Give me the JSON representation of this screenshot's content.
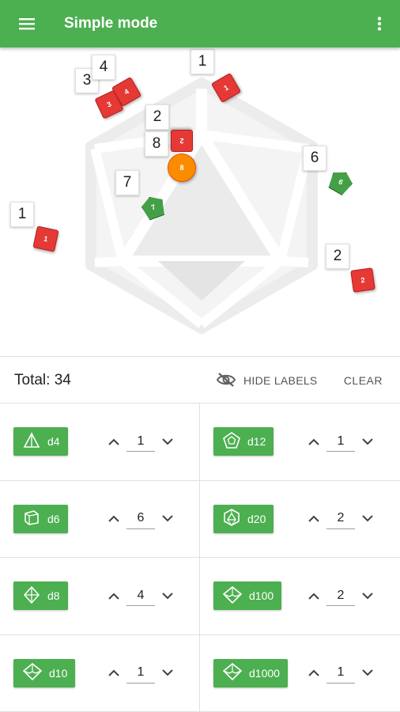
{
  "appbar": {
    "title": "Simple mode",
    "menu_icon": "menu-icon",
    "more_icon": "more-vert-icon",
    "color": "#4caf50"
  },
  "tray": {
    "dice": [
      {
        "label": "1",
        "face": "1",
        "color": "red"
      },
      {
        "label": "3",
        "face": "3",
        "color": "red"
      },
      {
        "label": "4",
        "face": "4",
        "color": "red"
      },
      {
        "label": "1",
        "face": "1",
        "color": "red"
      },
      {
        "label": "2",
        "face": "2",
        "color": "red"
      },
      {
        "label": "8",
        "face": "8",
        "color": "orange"
      },
      {
        "label": "7",
        "face": "7",
        "color": "green"
      },
      {
        "label": "6",
        "face": "6",
        "color": "green"
      },
      {
        "label": "2",
        "face": "2",
        "color": "red"
      }
    ]
  },
  "toolbar": {
    "total": "Total: 34",
    "hide_labels": "HIDE LABELS",
    "clear": "CLEAR"
  },
  "dice_types": [
    {
      "name": "d4",
      "count": "1",
      "icon": "d4-icon"
    },
    {
      "name": "d12",
      "count": "1",
      "icon": "d12-icon"
    },
    {
      "name": "d6",
      "count": "6",
      "icon": "d6-icon"
    },
    {
      "name": "d20",
      "count": "2",
      "icon": "d20-icon"
    },
    {
      "name": "d8",
      "count": "4",
      "icon": "d8-icon"
    },
    {
      "name": "d100",
      "count": "2",
      "icon": "d100-icon"
    },
    {
      "name": "d10",
      "count": "1",
      "icon": "d10-icon"
    },
    {
      "name": "d1000",
      "count": "1",
      "icon": "d1000-icon"
    }
  ]
}
